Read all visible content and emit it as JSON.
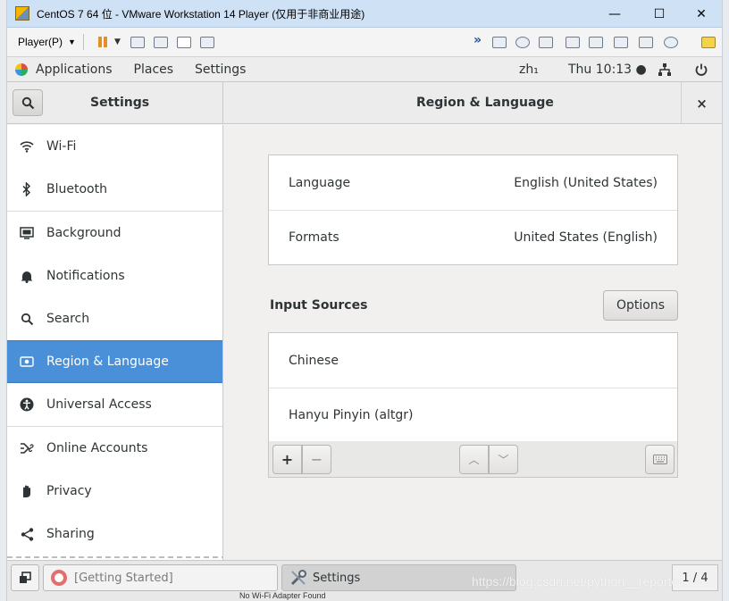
{
  "vmware": {
    "title": "CentOS 7 64 位 - VMware Workstation 14 Player (仅用于非商业用途)",
    "minimize": "—",
    "maximize": "☐",
    "close": "✕",
    "player_menu": "Player(P)",
    "toolbar_icons": [
      "pause-icon",
      "send-ctrl-alt-del-icon",
      "removable-devices-icon",
      "fullscreen-icon",
      "unity-icon",
      "more-icon",
      "hdd-icon",
      "cd-icon",
      "network-icon",
      "printer-icon",
      "usb-icon",
      "sound-icon",
      "display-icon",
      "camera-icon",
      "message-log-icon"
    ]
  },
  "gnome": {
    "applications": "Applications",
    "places": "Places",
    "settings": "Settings",
    "input_method": "zh₁",
    "clock": "Thu 10:13 ●"
  },
  "settings": {
    "sidebar_title": "Settings",
    "panel_title": "Region & Language",
    "close_label": "×",
    "sidebar": {
      "items": [
        {
          "label": "Wi-Fi"
        },
        {
          "label": "Bluetooth"
        },
        {
          "label": "Background"
        },
        {
          "label": "Notifications"
        },
        {
          "label": "Search"
        },
        {
          "label": "Region & Language"
        },
        {
          "label": "Universal Access"
        },
        {
          "label": "Online Accounts"
        },
        {
          "label": "Privacy"
        },
        {
          "label": "Sharing"
        }
      ],
      "selected": "Region & Language"
    },
    "language_formats": [
      {
        "label": "Language",
        "value": "English (United States)"
      },
      {
        "label": "Formats",
        "value": "United States (English)"
      }
    ],
    "input_sources_title": "Input Sources",
    "options_label": "Options",
    "input_sources": [
      "Chinese",
      "Hanyu Pinyin (altgr)"
    ],
    "toolbar": {
      "add": "+",
      "remove": "−",
      "up": "︿",
      "down": "﹀"
    }
  },
  "taskbar": {
    "getting_started": "[Getting Started]",
    "settings": "Settings",
    "pager": "1 / 4"
  },
  "watermark": "https://blog.csdn.net/python__reporter",
  "under_text": "No Wi-Fi Adapter Found",
  "colors": {
    "selected": "#4a90d9",
    "vm_title_bg": "#cfe1f5"
  }
}
